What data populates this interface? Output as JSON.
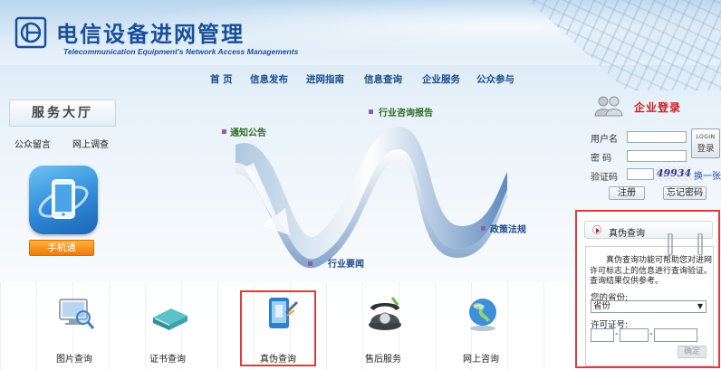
{
  "header": {
    "title": "电信设备进网管理",
    "subtitle": "Telecommunication Equipment's Network Access Managements"
  },
  "nav": {
    "items": [
      "首 页",
      "信息发布",
      "进网指南",
      "信息查询",
      "企业服务",
      "公众参与"
    ]
  },
  "left": {
    "hall_title": "服务大厅",
    "links": [
      "公众留言",
      "网上调查"
    ],
    "mobile_app_icon": "phone-app-icon",
    "mobile_button": "手机通"
  },
  "wave": {
    "labels": {
      "notice": "通知公告",
      "consult": "行业咨询报告",
      "policy": "政策法规",
      "news": "行业要闻"
    }
  },
  "bottom": {
    "items": [
      {
        "label": "图片查询",
        "icon": "picture-search-icon"
      },
      {
        "label": "证书查询",
        "icon": "certificate-icon"
      },
      {
        "label": "真伪查询",
        "icon": "verify-phone-icon"
      },
      {
        "label": "售后服务",
        "icon": "telephone-icon"
      },
      {
        "label": "网上咨询",
        "icon": "globe-icon"
      }
    ]
  },
  "login": {
    "title": "企业登录",
    "username_label": "用户名",
    "password_label": "密  码",
    "captcha_label": "验证码",
    "captcha_value": "49934",
    "refresh_label": "换一张",
    "login_button_top": "LOGIN",
    "login_button_bottom": "登录",
    "register_button": "注册",
    "forgot_button": "忘记密码"
  },
  "verify": {
    "title": "真伪查询",
    "description": "真伪查询功能可帮助您对进网许可标志上的信息进行查询验证。查询结果仅供参考。",
    "province_label": "您的省份:",
    "province_value": "省份",
    "license_label": "许可证号:",
    "confirm_button": "确定"
  },
  "colors": {
    "brand_blue": "#1a4f9a",
    "login_red": "#d2191b",
    "highlight_red": "#e23b3b",
    "button_orange": "#f07a0a"
  }
}
